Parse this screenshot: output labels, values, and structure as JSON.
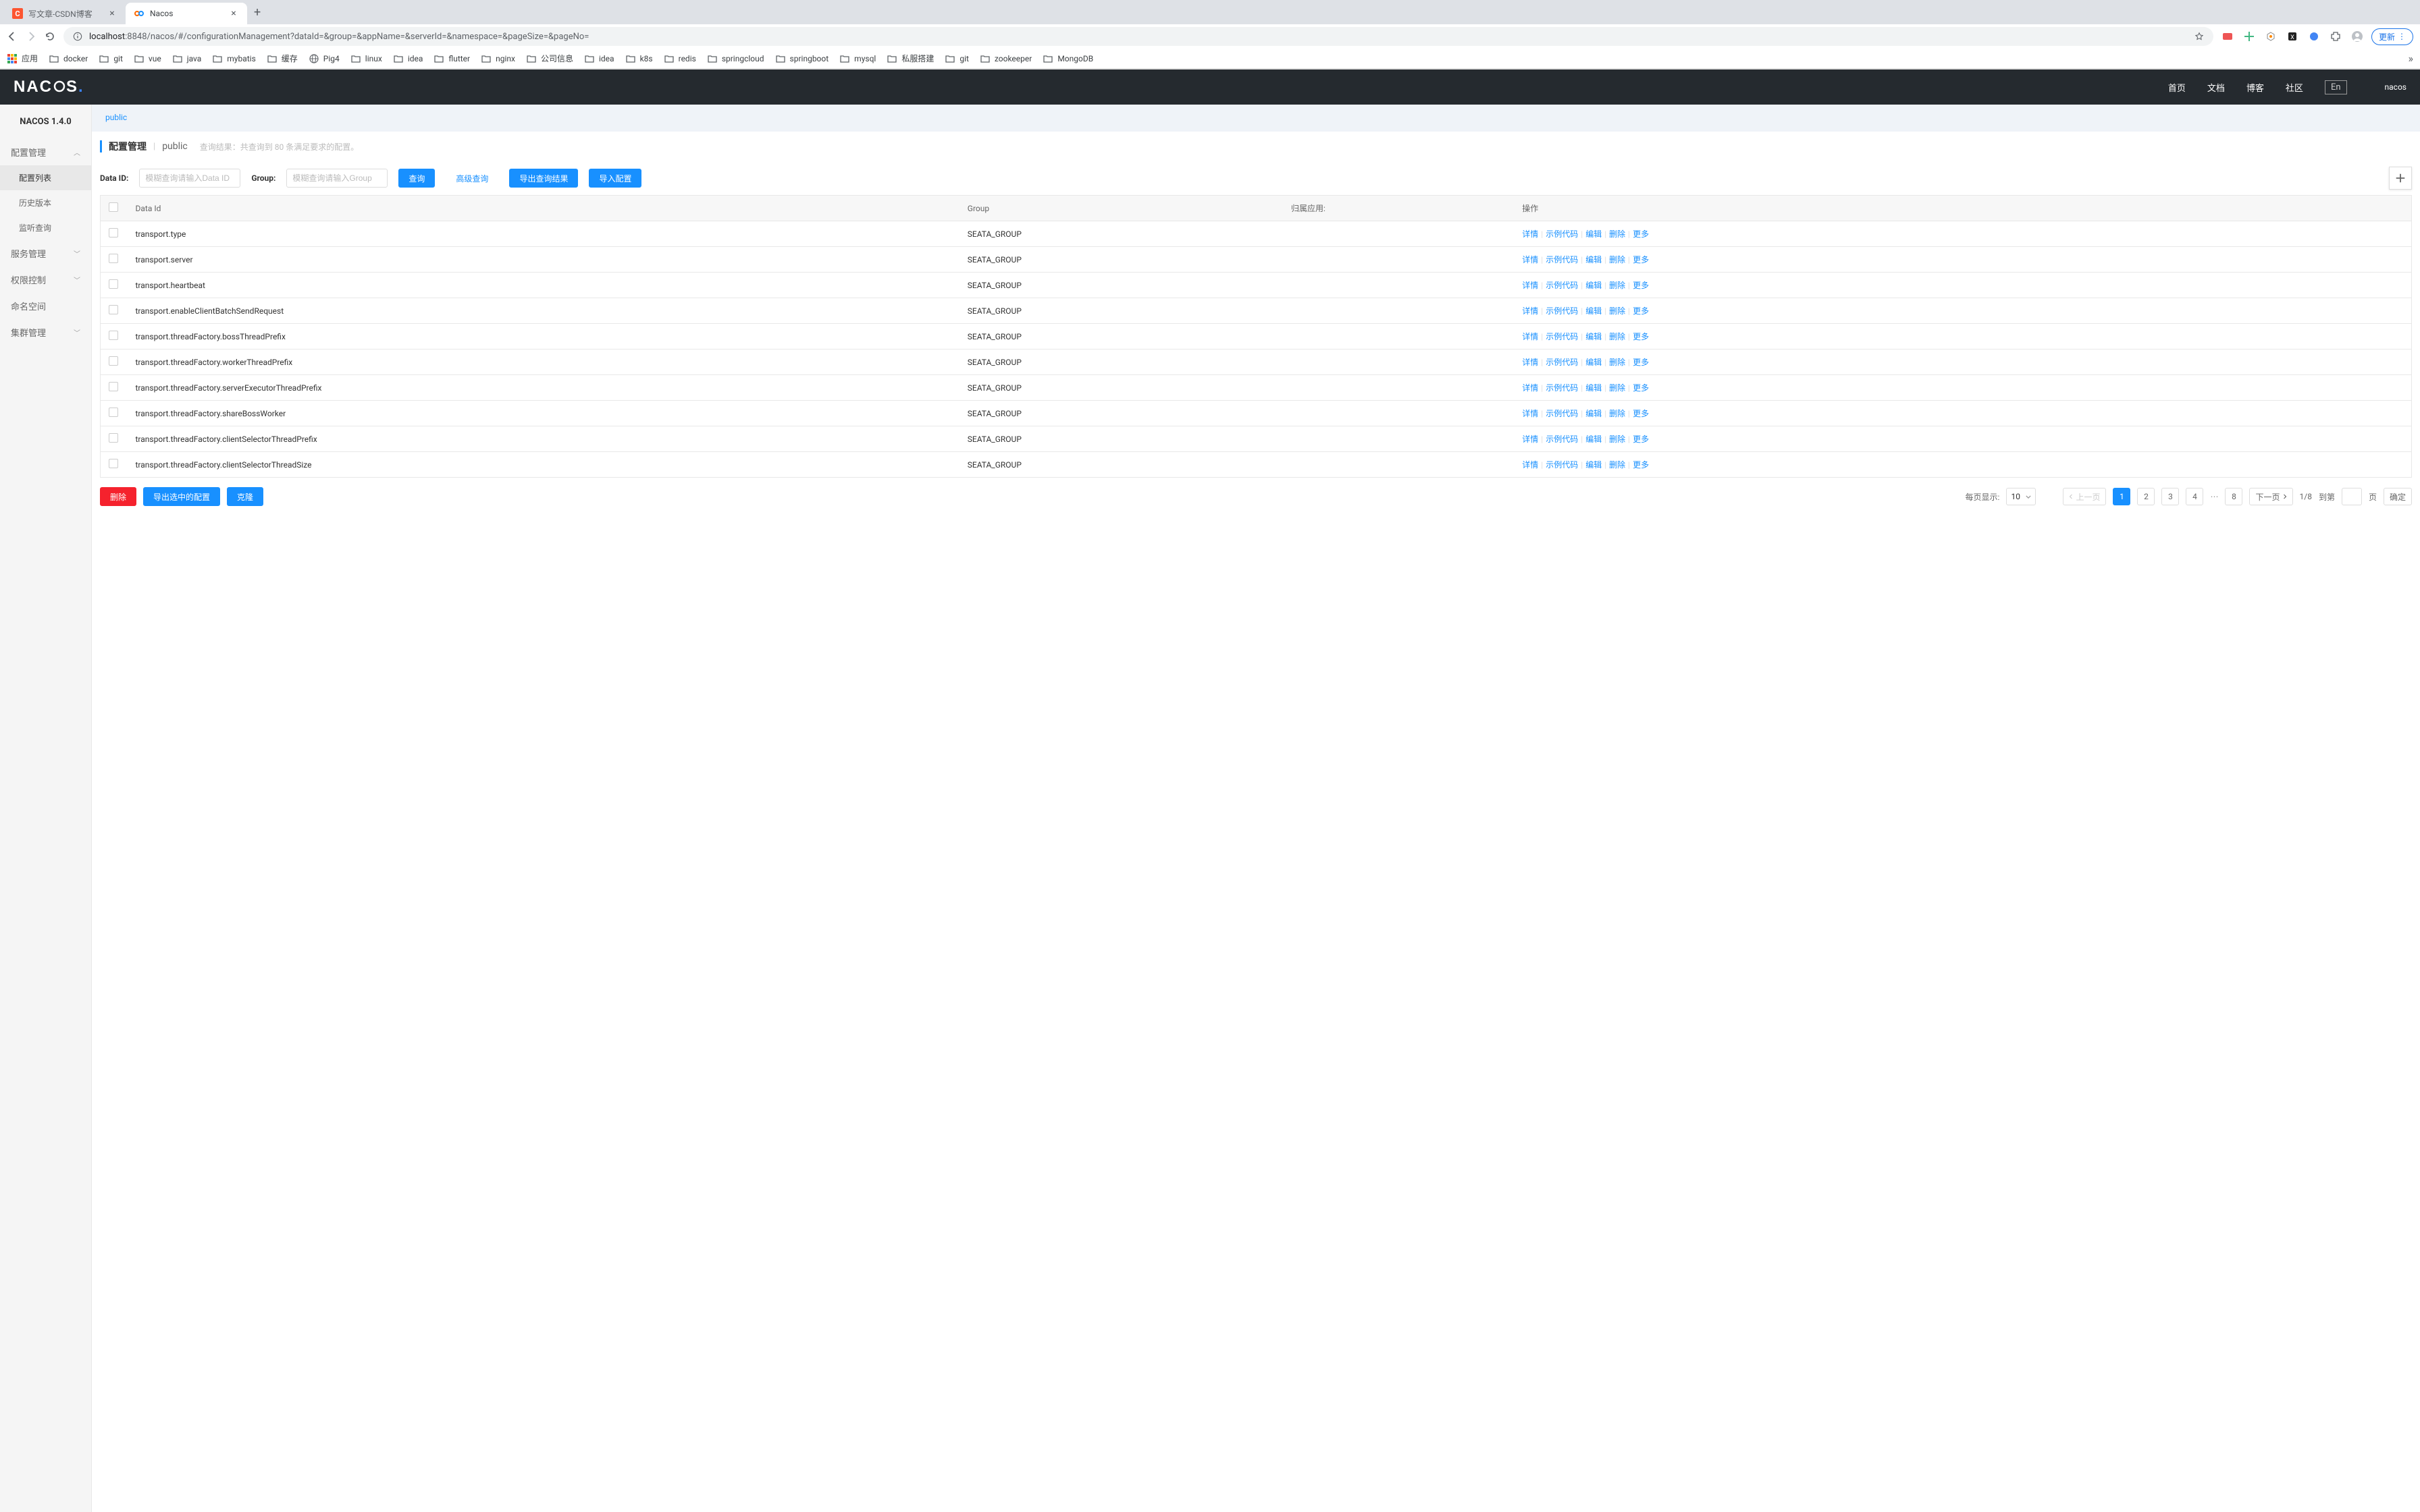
{
  "browser": {
    "tabs": [
      {
        "title": "写文章-CSDN博客",
        "active": false
      },
      {
        "title": "Nacos",
        "active": true
      }
    ],
    "url_host": "localhost",
    "url_rest": ":8848/nacos/#/configurationManagement?dataId=&group=&appName=&serverId=&namespace=&pageSize=&pageNo=",
    "update_label": "更新",
    "bookmarks": [
      "应用",
      "docker",
      "git",
      "vue",
      "java",
      "mybatis",
      "缓存",
      "Pig4",
      "linux",
      "idea",
      "flutter",
      "nginx",
      "公司信息",
      "idea",
      "k8s",
      "redis",
      "springcloud",
      "springboot",
      "mysql",
      "私服搭建",
      "git",
      "zookeeper",
      "MongoDB"
    ]
  },
  "header": {
    "nav": [
      "首页",
      "文档",
      "博客",
      "社区"
    ],
    "lang": "En",
    "user": "nacos"
  },
  "sidebar": {
    "title": "NACOS 1.4.0",
    "groups": [
      {
        "label": "配置管理",
        "open": true,
        "items": [
          "配置列表",
          "历史版本",
          "监听查询"
        ],
        "activeIndex": 0
      },
      {
        "label": "服务管理",
        "open": false
      },
      {
        "label": "权限控制",
        "open": false
      },
      {
        "label": "命名空间",
        "open": false,
        "noArrow": true
      },
      {
        "label": "集群管理",
        "open": false
      }
    ]
  },
  "content": {
    "namespace_tab": "public",
    "title_main": "配置管理",
    "title_sep": "|",
    "title_sub": "public",
    "title_desc": "查询结果：共查询到 80 条满足要求的配置。",
    "search": {
      "dataid_label": "Data ID:",
      "dataid_placeholder": "模糊查询请输入Data ID",
      "group_label": "Group:",
      "group_placeholder": "模糊查询请输入Group",
      "btn_query": "查询",
      "btn_adv": "高级查询",
      "btn_export": "导出查询结果",
      "btn_import": "导入配置"
    },
    "table": {
      "headers": [
        "Data Id",
        "Group",
        "归属应用:",
        "操作"
      ],
      "ops": [
        "详情",
        "示例代码",
        "编辑",
        "删除",
        "更多"
      ],
      "rows": [
        {
          "dataId": "transport.type",
          "group": "SEATA_GROUP",
          "app": ""
        },
        {
          "dataId": "transport.server",
          "group": "SEATA_GROUP",
          "app": ""
        },
        {
          "dataId": "transport.heartbeat",
          "group": "SEATA_GROUP",
          "app": ""
        },
        {
          "dataId": "transport.enableClientBatchSendRequest",
          "group": "SEATA_GROUP",
          "app": ""
        },
        {
          "dataId": "transport.threadFactory.bossThreadPrefix",
          "group": "SEATA_GROUP",
          "app": ""
        },
        {
          "dataId": "transport.threadFactory.workerThreadPrefix",
          "group": "SEATA_GROUP",
          "app": ""
        },
        {
          "dataId": "transport.threadFactory.serverExecutorThreadPrefix",
          "group": "SEATA_GROUP",
          "app": ""
        },
        {
          "dataId": "transport.threadFactory.shareBossWorker",
          "group": "SEATA_GROUP",
          "app": ""
        },
        {
          "dataId": "transport.threadFactory.clientSelectorThreadPrefix",
          "group": "SEATA_GROUP",
          "app": ""
        },
        {
          "dataId": "transport.threadFactory.clientSelectorThreadSize",
          "group": "SEATA_GROUP",
          "app": ""
        }
      ]
    },
    "footer": {
      "btn_delete": "删除",
      "btn_export_sel": "导出选中的配置",
      "btn_clone": "克隆",
      "page_size_label": "每页显示:",
      "page_size": "10",
      "prev": "上一页",
      "next": "下一页",
      "pages": [
        "1",
        "2",
        "3",
        "4"
      ],
      "last_page": "8",
      "page_info": "1/8",
      "goto_label": "到第",
      "page_unit": "页",
      "confirm": "确定"
    }
  },
  "chart_data": null
}
